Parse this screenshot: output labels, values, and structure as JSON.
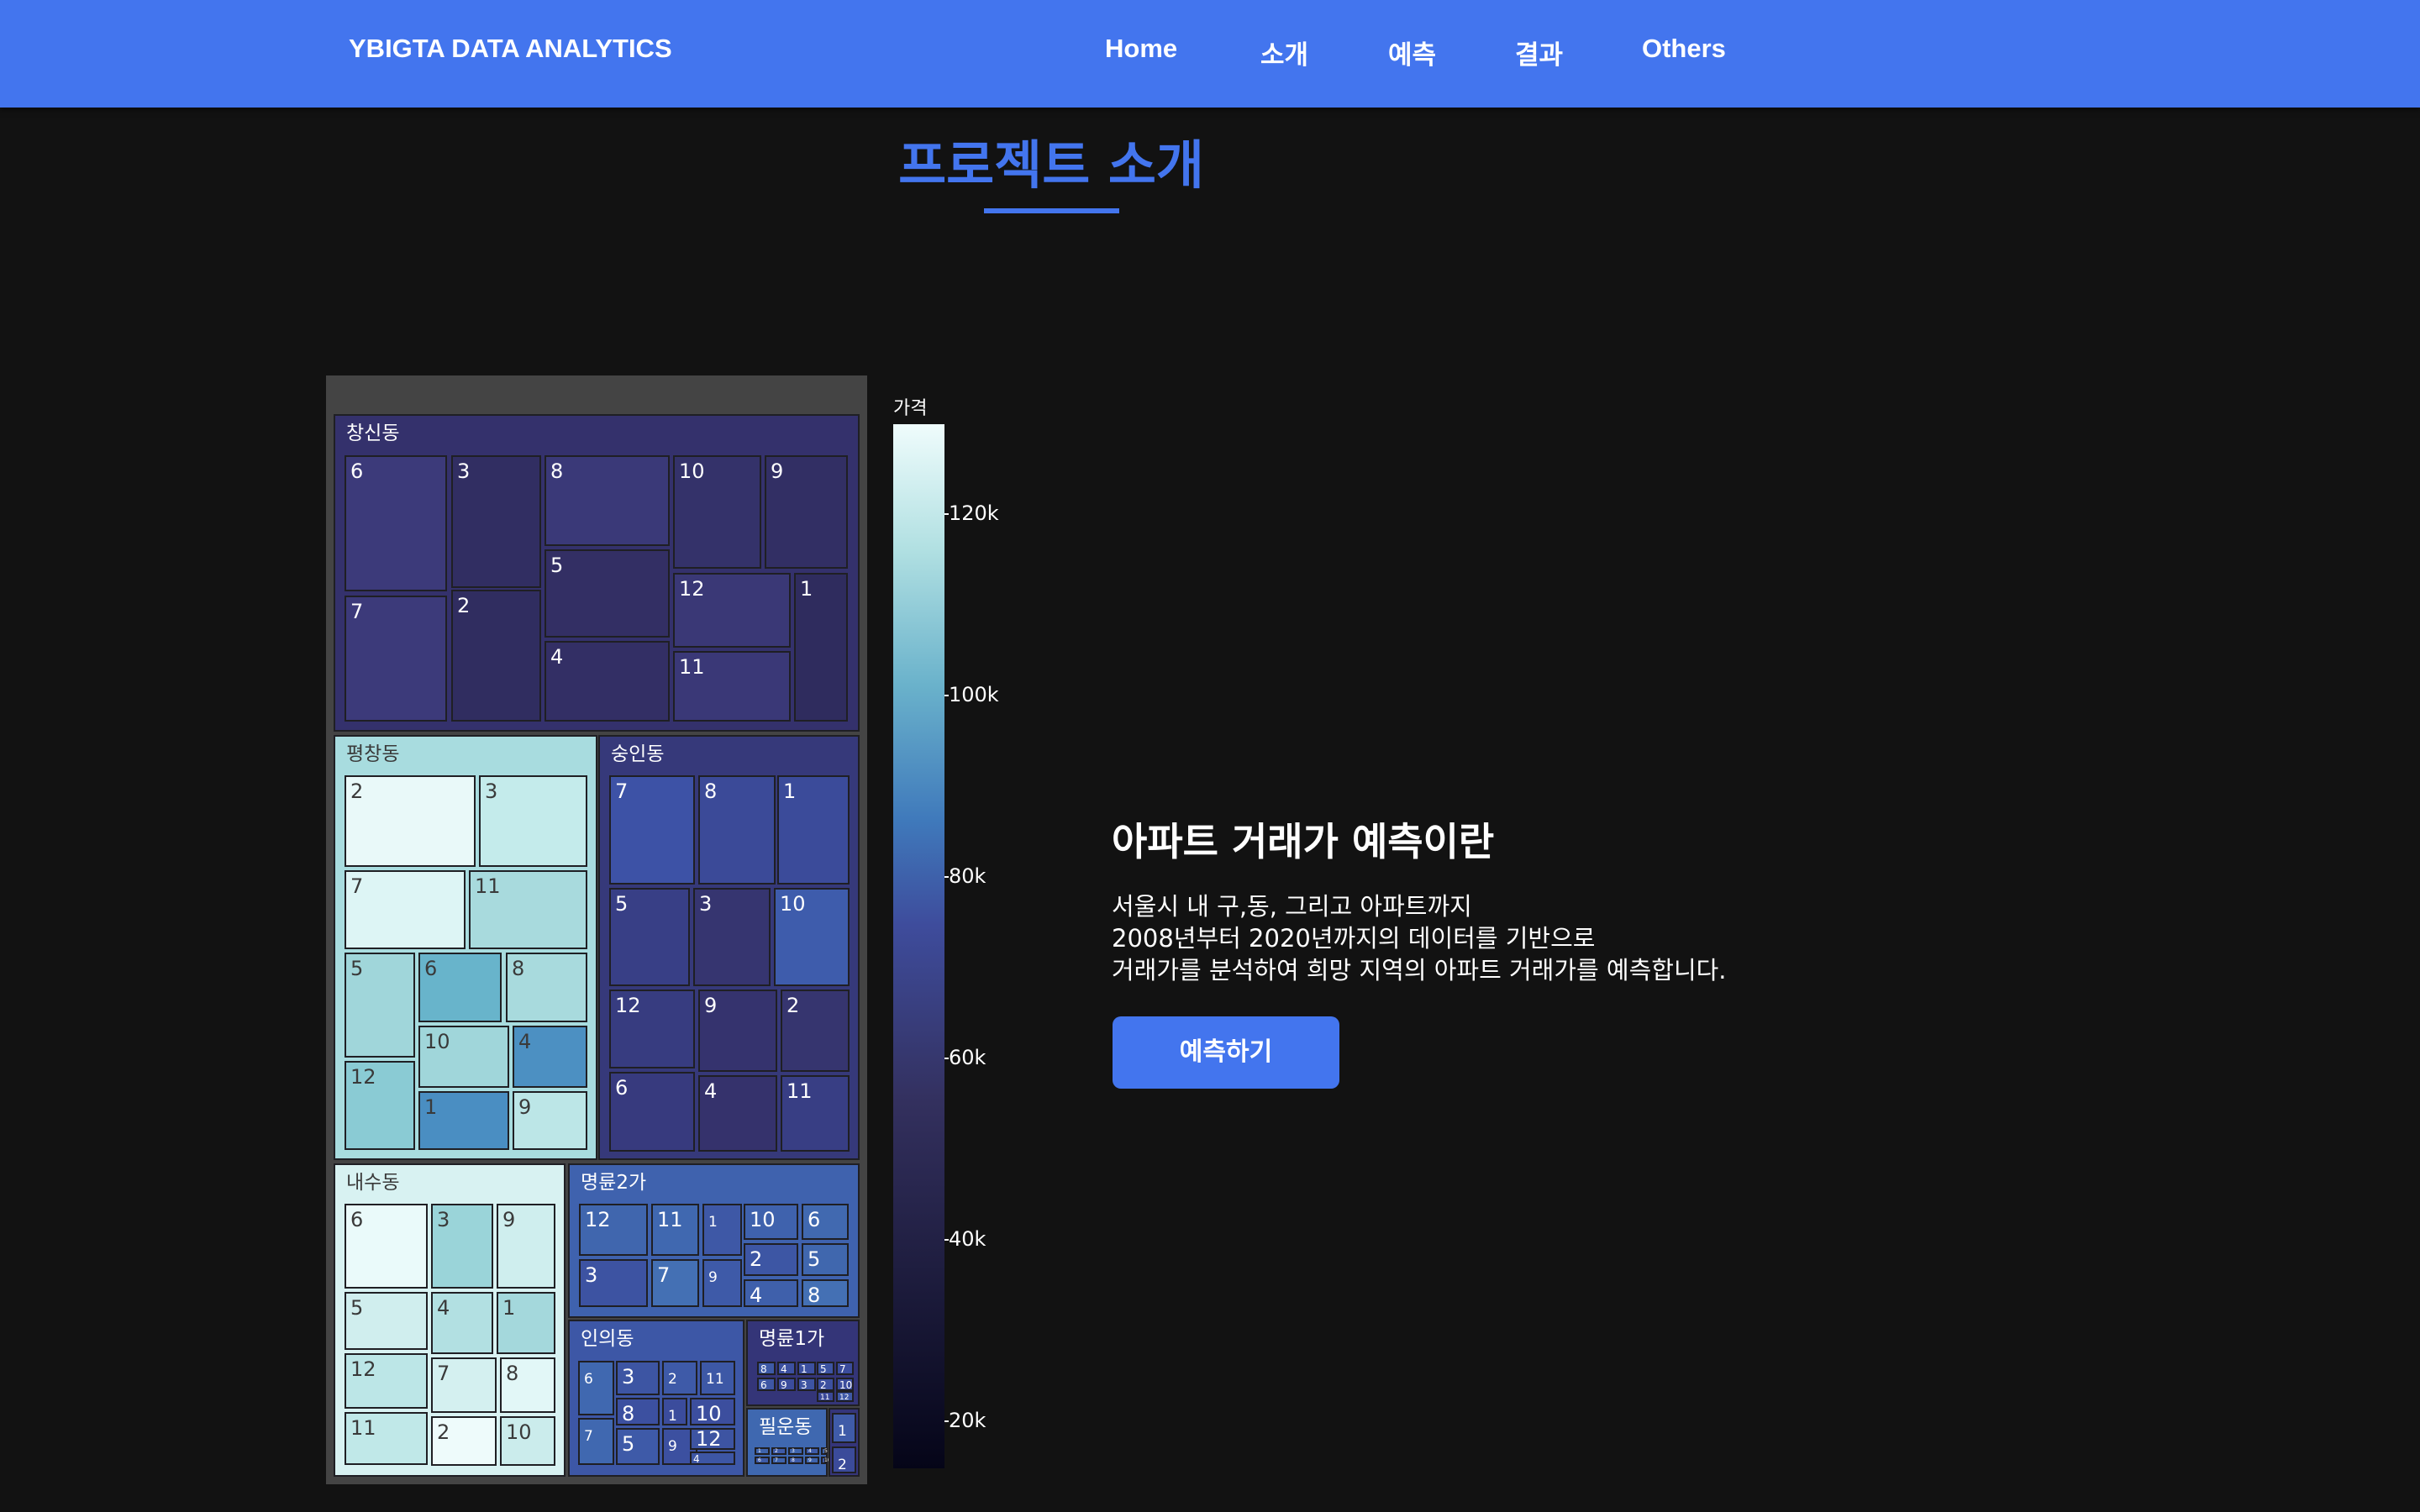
{
  "header": {
    "brand": "YBIGTA DATA ANALYTICS",
    "nav": [
      "Home",
      "소개",
      "예측",
      "결과",
      "Others"
    ]
  },
  "page_title": "프로젝트 소개",
  "colors": {
    "accent": "#4375ee",
    "background": "#121212",
    "treemap_frame": "#444444"
  },
  "treemap": {
    "colorbar_title": "가격",
    "colorbar_ticks": [
      "120k",
      "100k",
      "80k",
      "60k",
      "40k",
      "20k"
    ],
    "colorscale": [
      "#050518",
      "#33305e",
      "#3e4c9c",
      "#6ab2cb",
      "#effcfc"
    ],
    "groups": [
      {
        "name": "창신동",
        "color": "#34316c",
        "dark": false,
        "cells": [
          [
            "6",
            "#3c3a7a"
          ],
          [
            "3",
            "#312e62"
          ],
          [
            "8",
            "#3a3978"
          ],
          [
            "10",
            "#34326a"
          ],
          [
            "9",
            "#322f64"
          ],
          [
            "7",
            "#3c3a7a"
          ],
          [
            "2",
            "#302d60"
          ],
          [
            "5",
            "#332f64"
          ],
          [
            "12",
            "#3a3876"
          ],
          [
            "1",
            "#2f2c5e"
          ],
          [
            "4",
            "#332f65"
          ],
          [
            "11",
            "#3a3877"
          ]
        ]
      },
      {
        "name": "평창동",
        "color": "#a8dcdf",
        "dark": true,
        "cells": [
          [
            "2",
            "#e9f9f9"
          ],
          [
            "3",
            "#c4ebeb"
          ],
          [
            "7",
            "#ddf5f5"
          ],
          [
            "11",
            "#a8dadd"
          ],
          [
            "5",
            "#a0d6da"
          ],
          [
            "6",
            "#68b4cb"
          ],
          [
            "8",
            "#a8dadd"
          ],
          [
            "10",
            "#a0d6da"
          ],
          [
            "4",
            "#4c90c2"
          ],
          [
            "12",
            "#8acbd4"
          ],
          [
            "1",
            "#4a8ec2"
          ],
          [
            "9",
            "#bce6e7"
          ]
        ]
      },
      {
        "name": "숭인동",
        "color": "#36397a",
        "dark": false,
        "cells": [
          [
            "7",
            "#3d52a6"
          ],
          [
            "8",
            "#3b4a98"
          ],
          [
            "1",
            "#3b4b9a"
          ],
          [
            "5",
            "#383f86"
          ],
          [
            "3",
            "#363570"
          ],
          [
            "10",
            "#3e5cac"
          ],
          [
            "12",
            "#373c80"
          ],
          [
            "9",
            "#35336e"
          ],
          [
            "2",
            "#36356f"
          ],
          [
            "6",
            "#373a7e"
          ],
          [
            "4",
            "#35326c"
          ],
          [
            "11",
            "#383e84"
          ]
        ]
      },
      {
        "name": "내수동",
        "color": "#d8f2f2",
        "dark": true,
        "cells": [
          [
            "6",
            "#eafafa"
          ],
          [
            "3",
            "#9ad4d9"
          ],
          [
            "9",
            "#cfeeee"
          ],
          [
            "5",
            "#d0eeee"
          ],
          [
            "4",
            "#b2e0e2"
          ],
          [
            "1",
            "#a4d8dc"
          ],
          [
            "12",
            "#bce6e7"
          ],
          [
            "7",
            "#d4f0f0"
          ],
          [
            "8",
            "#e2f7f7"
          ],
          [
            "11",
            "#c0e8e8"
          ],
          [
            "2",
            "#eefbfb"
          ],
          [
            "10",
            "#cbecec"
          ]
        ]
      },
      {
        "name": "명륜2가",
        "color": "#3f62ae",
        "dark": false,
        "cells": [
          [
            "12",
            "#4066ae"
          ],
          [
            "11",
            "#4068b0"
          ],
          [
            "1",
            "#3e58a6"
          ],
          [
            "10",
            "#3f62ad"
          ],
          [
            "6",
            "#4169b0"
          ],
          [
            "2",
            "#3d56a4"
          ],
          [
            "5",
            "#4067ae"
          ],
          [
            "3",
            "#3d53a2"
          ],
          [
            "7",
            "#4470b4"
          ],
          [
            "9",
            "#3e5aa8"
          ],
          [
            "4",
            "#3f60ab"
          ],
          [
            "8",
            "#4470b4"
          ]
        ]
      },
      {
        "name": "인의동",
        "color": "#3d57a6",
        "dark": false,
        "cells": [
          [
            "6",
            "#4068b0"
          ],
          [
            "3",
            "#3d55a3"
          ],
          [
            "2",
            "#3e5aa8"
          ],
          [
            "11",
            "#3d58a6"
          ],
          [
            "8",
            "#3c50a0"
          ],
          [
            "1",
            "#3b4c9c"
          ],
          [
            "10",
            "#3c4e9e"
          ],
          [
            "7",
            "#4068b0"
          ],
          [
            "5",
            "#3e5aa8"
          ],
          [
            "9",
            "#3c50a0"
          ],
          [
            "12",
            "#3d54a2"
          ],
          [
            "4",
            "#3d56a4"
          ]
        ]
      },
      {
        "name": "명륜1가",
        "color": "#343578",
        "dark": false,
        "cells": [
          [
            "8",
            "#3e5aa6"
          ],
          [
            "4",
            "#3c50a0"
          ],
          [
            "1",
            "#3c50a0"
          ],
          [
            "5",
            "#3d54a2"
          ],
          [
            "7",
            "#3b4c9c"
          ],
          [
            "6",
            "#3e56a4"
          ],
          [
            "9",
            "#3b4c9c"
          ],
          [
            "3",
            "#3d54a2"
          ],
          [
            "2",
            "#3c50a0"
          ],
          [
            "10",
            "#3b4c9c"
          ],
          [
            "11",
            "#3a4898"
          ],
          [
            "12",
            "#3e58a6"
          ]
        ]
      },
      {
        "name": "필운동",
        "color": "#3f68b0",
        "dark": false,
        "cells": [
          [
            "1",
            "#3f64ad"
          ],
          [
            "2",
            "#3e5ba8"
          ],
          [
            "3",
            "#3f64ad"
          ],
          [
            "4",
            "#3e5ba8"
          ],
          [
            "5",
            "#3f64ad"
          ],
          [
            "6",
            "#3e5ba8"
          ],
          [
            "7",
            "#3f64ad"
          ],
          [
            "8",
            "#3e5ba8"
          ],
          [
            "9",
            "#3f64ad"
          ],
          [
            "10",
            "#3e5ba8"
          ]
        ]
      },
      {
        "name": "",
        "color": "#35357a",
        "dark": false,
        "cells": [
          [
            "1",
            "#3f5ba8"
          ],
          [
            "2",
            "#3b4b9a"
          ]
        ]
      }
    ]
  },
  "info": {
    "heading": "아파트 거래가 예측이란",
    "lines": [
      "서울시 내 구,동, 그리고 아파트까지",
      "2008년부터 2020년까지의 데이터를 기반으로",
      "거래가를 분석하여 희망 지역의 아파트 거래가를 예측합니다."
    ],
    "cta_label": "예측하기"
  }
}
